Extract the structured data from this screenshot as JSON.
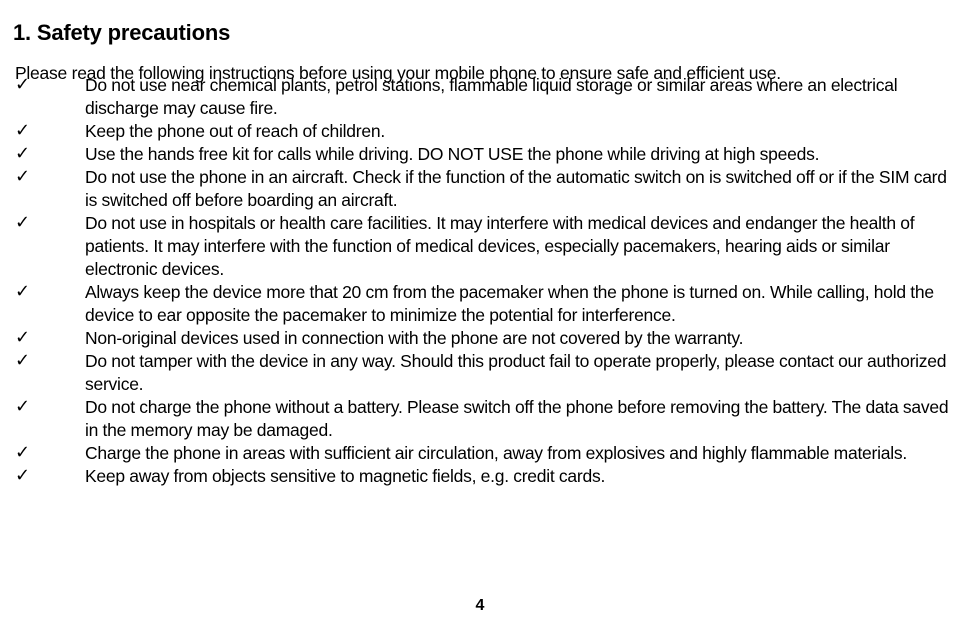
{
  "document": {
    "title": "1. Safety precautions",
    "intro": "Please read the following instructions before using your mobile phone to ensure safe and efficient use.",
    "bullet_glyph": "✓",
    "page_number": "4",
    "bullets": [
      "Do not use near chemical plants, petrol stations, flammable liquid storage or similar areas where an electrical discharge may cause fire.",
      "Keep the phone out of reach of children.",
      "Use the hands free kit for calls while driving. DO NOT USE the phone while driving at high speeds.",
      "Do not use the phone in an aircraft. Check if the function of the automatic switch on is switched off or if the SIM card is switched off before boarding an aircraft.",
      "Do not use in hospitals or health care facilities. It may interfere with medical devices and endanger the health of patients. It may interfere with the function of medical devices, especially pacemakers, hearing aids or similar electronic devices.",
      "Always keep the device more that 20 cm from the pacemaker when the phone is turned on. While calling, hold the device to ear opposite the pacemaker to minimize the potential for interference.",
      "Non-original devices used in connection with the phone are not covered by the warranty.",
      "Do not tamper with the device in any way. Should this product fail to operate properly, please contact our authorized service.",
      "Do not charge the phone without a battery. Please switch off the phone before removing the battery. The data saved in the memory may be damaged.",
      "Charge the phone in areas with sufficient air circulation, away from explosives and highly flammable materials.",
      "Keep away from objects sensitive to magnetic fields, e.g. credit cards."
    ]
  }
}
